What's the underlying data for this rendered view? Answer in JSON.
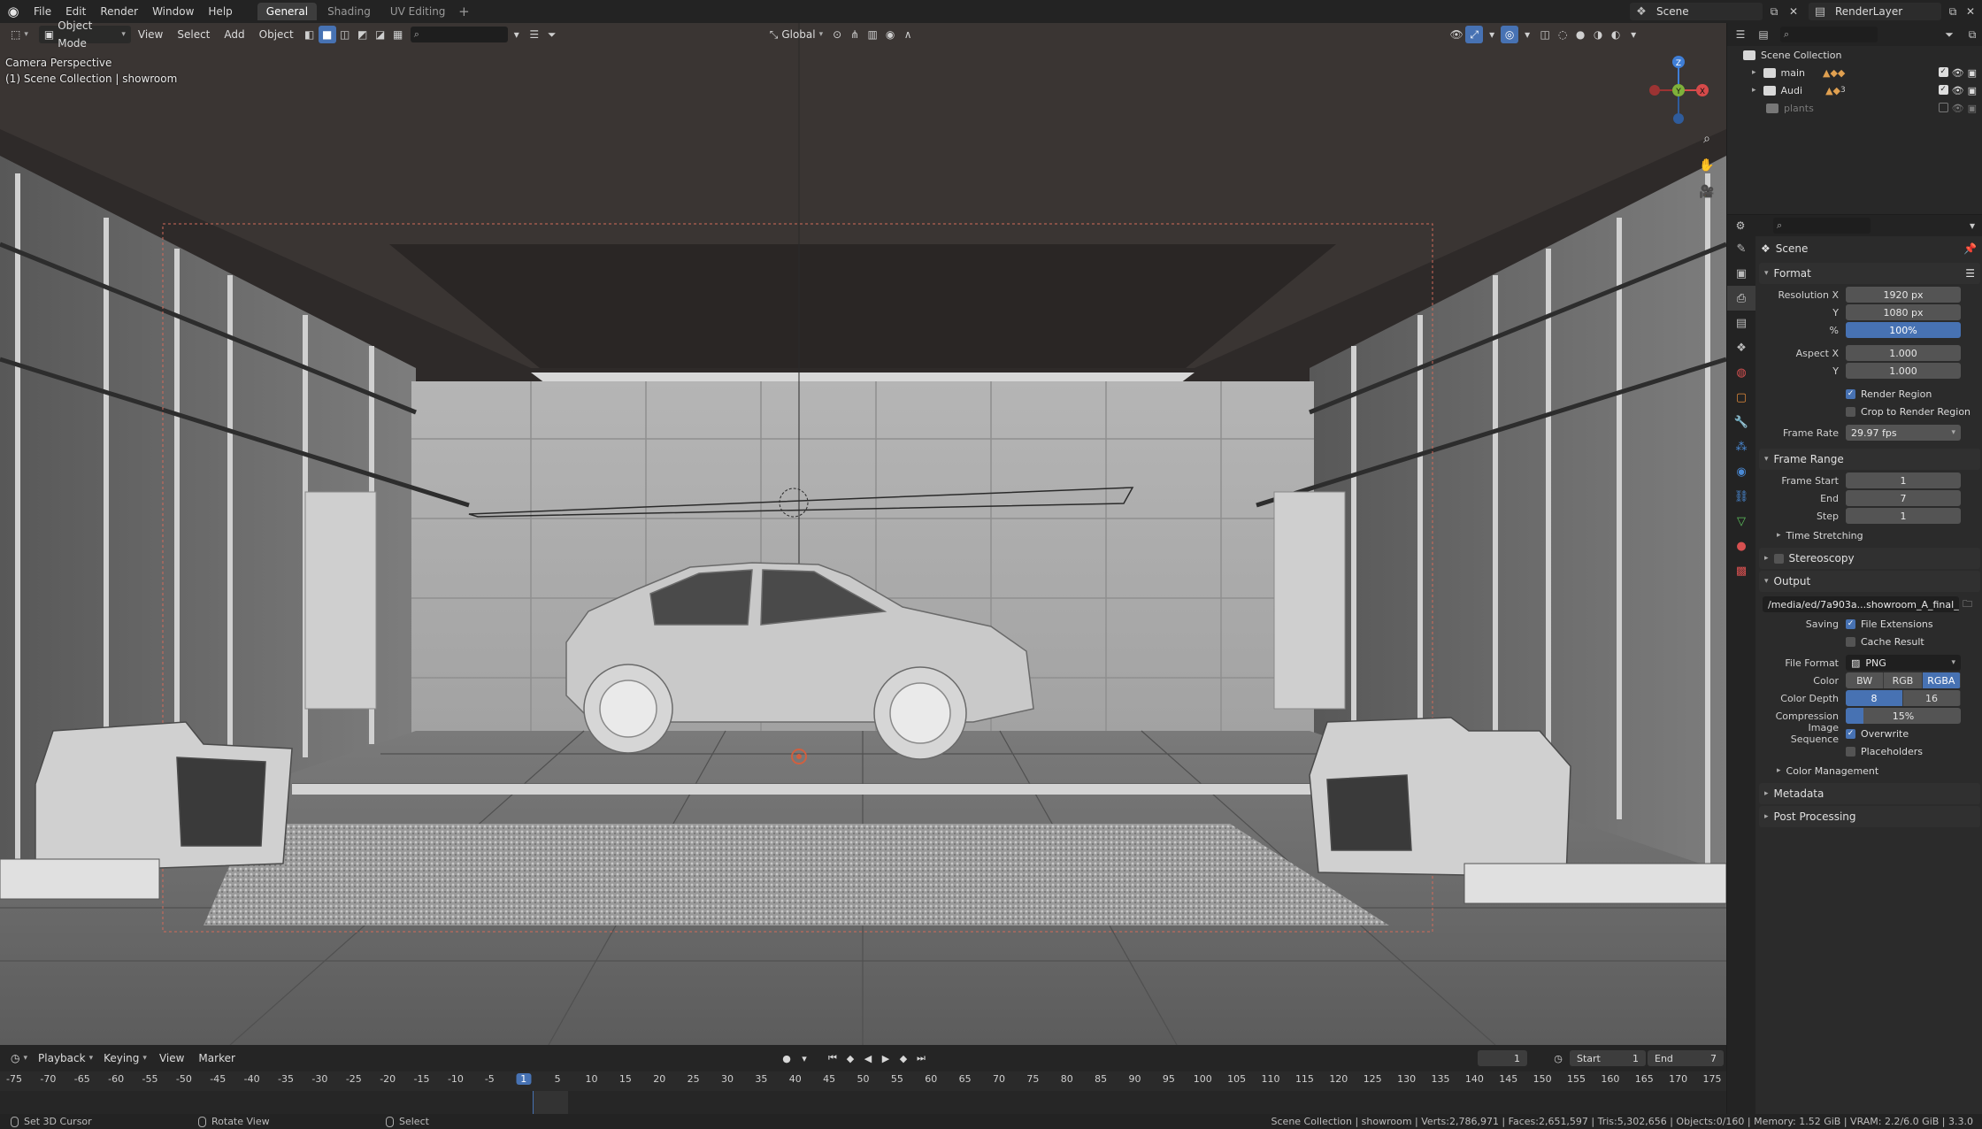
{
  "topbar": {
    "menus": [
      "File",
      "Edit",
      "Render",
      "Window",
      "Help"
    ],
    "workspaces": [
      {
        "label": "General",
        "active": true
      },
      {
        "label": "Shading",
        "active": false
      },
      {
        "label": "UV Editing",
        "active": false
      }
    ],
    "scene_name": "Scene",
    "view_layer": "RenderLayer"
  },
  "viewport_header": {
    "mode": "Object Mode",
    "menus": [
      "View",
      "Select",
      "Add",
      "Object"
    ],
    "orientation": "Global"
  },
  "viewport": {
    "camera_label": "Camera Perspective",
    "collection_label": "(1) Scene Collection | showroom"
  },
  "gizmo": {
    "z": "Z",
    "y": "Y",
    "x": "X"
  },
  "outliner": {
    "root": "Scene Collection",
    "items": [
      {
        "name": "main",
        "badge": "",
        "visible": true
      },
      {
        "name": "Audi",
        "badge": "3",
        "visible": true
      },
      {
        "name": "plants",
        "badge": "",
        "visible": false
      }
    ]
  },
  "properties": {
    "context": "Scene",
    "format": {
      "title": "Format",
      "resolution_x_label": "Resolution X",
      "resolution_x": "1920 px",
      "y_label": "Y",
      "resolution_y": "1080 px",
      "percent_label": "%",
      "percent": "100%",
      "aspect_x_label": "Aspect X",
      "aspect_x": "1.000",
      "aspect_y": "1.000",
      "render_region": "Render Region",
      "crop_region": "Crop to Render Region",
      "frame_rate_label": "Frame Rate",
      "frame_rate": "29.97 fps"
    },
    "frame_range": {
      "title": "Frame Range",
      "start_label": "Frame Start",
      "start": "1",
      "end_label": "End",
      "end": "7",
      "step_label": "Step",
      "step": "1",
      "time_stretching": "Time Stretching"
    },
    "stereoscopy": "Stereoscopy",
    "output": {
      "title": "Output",
      "path": "/media/ed/7a903a...showroom_A_final_",
      "saving_label": "Saving",
      "file_extensions": "File Extensions",
      "cache_result": "Cache Result",
      "file_format_label": "File Format",
      "file_format": "PNG",
      "color_label": "Color",
      "color_options": [
        "BW",
        "RGB",
        "RGBA"
      ],
      "color_depth_label": "Color Depth",
      "depth_options": [
        "8",
        "16"
      ],
      "compression_label": "Compression",
      "compression": "15%",
      "compression_fraction": 0.15,
      "image_sequence_label": "Image Sequence",
      "overwrite": "Overwrite",
      "placeholders": "Placeholders",
      "color_management": "Color Management"
    },
    "metadata": "Metadata",
    "post_processing": "Post Processing"
  },
  "timeline": {
    "menus": [
      "Playback",
      "Keying",
      "View",
      "Marker"
    ],
    "current_frame": "1",
    "start_label": "Start",
    "start": "1",
    "end_label": "End",
    "end": "7",
    "ruler": [
      "-75",
      "-70",
      "-65",
      "-60",
      "-55",
      "-50",
      "-45",
      "-40",
      "-35",
      "-30",
      "-25",
      "-20",
      "-15",
      "-10",
      "-5",
      "1",
      "5",
      "10",
      "15",
      "20",
      "25",
      "30",
      "35",
      "40",
      "45",
      "50",
      "55",
      "60",
      "65",
      "70",
      "75",
      "80",
      "85",
      "90",
      "95",
      "100",
      "105",
      "110",
      "115",
      "120",
      "125",
      "130",
      "135",
      "140",
      "145",
      "150",
      "155",
      "160",
      "165",
      "170",
      "175"
    ]
  },
  "statusbar": {
    "hint1": "Set 3D Cursor",
    "hint2": "Rotate View",
    "hint3": "Select",
    "stats": "Scene Collection | showroom | Verts:2,786,971 | Faces:2,651,597 | Tris:5,302,656 | Objects:0/160 | Memory: 1.52 GiB | VRAM: 2.2/6.0 GiB | 3.3.0"
  },
  "colors": {
    "accent": "#4772b3",
    "panel": "#2b2b2b",
    "header": "#232323"
  }
}
